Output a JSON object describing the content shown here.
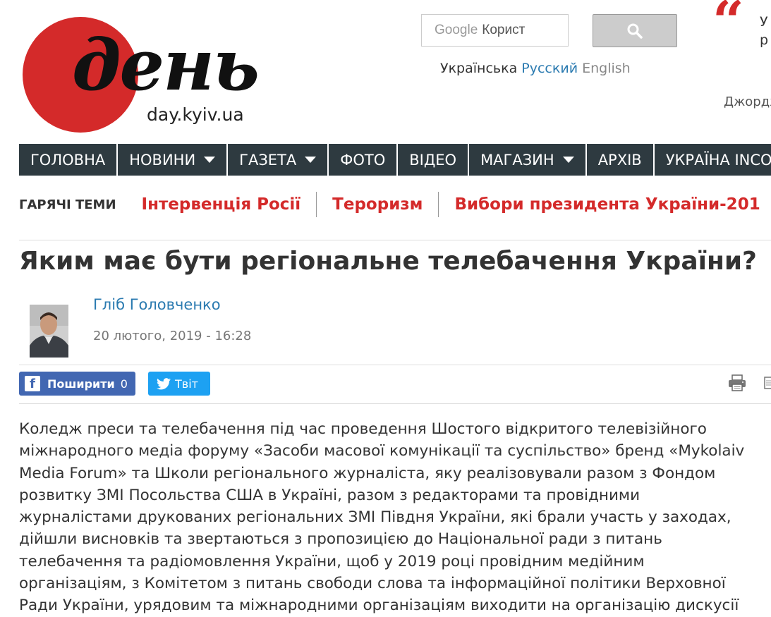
{
  "header": {
    "logo_word": "день",
    "logo_domain": "day.kyiv.ua",
    "search": {
      "google_label": "Google",
      "placeholder": "Корист"
    },
    "languages": [
      "Українська",
      "Русский",
      "English"
    ],
    "quote": {
      "mark": "“",
      "text_line1": "У",
      "text_line2": "р",
      "author": "Джордж"
    }
  },
  "nav": {
    "items": [
      {
        "label": "ГОЛОВНА"
      },
      {
        "label": "НОВИНИ"
      },
      {
        "label": "ГАЗЕТА"
      },
      {
        "label": "ФОТО"
      },
      {
        "label": "ВІДЕО"
      },
      {
        "label": "МАГАЗИН"
      },
      {
        "label": "АРХІВ"
      },
      {
        "label": "УКРАЇНА INCO"
      }
    ]
  },
  "hot_topics": {
    "label": "ГАРЯЧІ ТЕМИ",
    "links": [
      "Інтервенція Росії",
      "Тероризм",
      "Вибори президента України-201"
    ]
  },
  "article": {
    "title": "Яким має бути регіональне телебачення України?",
    "author": "Гліб Головченко",
    "date": "20 лютого, 2019 - 16:28",
    "share": {
      "facebook_label": "Поширити",
      "facebook_count": "0",
      "twitter_label": "Твіт"
    },
    "body": "Коледж преси та телебачення під час проведення Шостого відкритого телевізійного\nміжнародного медіа форуму «Засоби масової комунікації та суспільство» бренд «Mykolaiv\nMedia Forum» та Школи регіонального журналіста, яку реалізовували разом з Фондом\nрозвитку ЗМІ Посольства США в Україні, разом з редакторами та провідними\nжурналістами друкованих регіональних ЗМІ Півдня України, які брали участь у заходах,\nдійшли висновків та звертаються з пропозицією до Національної ради з питань\nтелебачення та радіомовлення України, щоб у 2019 році провідним медійним\nорганізаціям, з Комітетом з питань свободи слова та інформаційної політики Верховної\nРади України, урядовим та міжнародними організаціям виходити на організацію дискусії"
  },
  "colors": {
    "brand_red": "#d42a2a",
    "nav_bg": "#2e3a40",
    "link_blue": "#2a7ab0",
    "facebook": "#4267b2",
    "twitter": "#1da1f2"
  },
  "icons": [
    "search-icon",
    "facebook-icon",
    "twitter-icon",
    "print-icon",
    "more-icon",
    "chevron-down-icon"
  ]
}
